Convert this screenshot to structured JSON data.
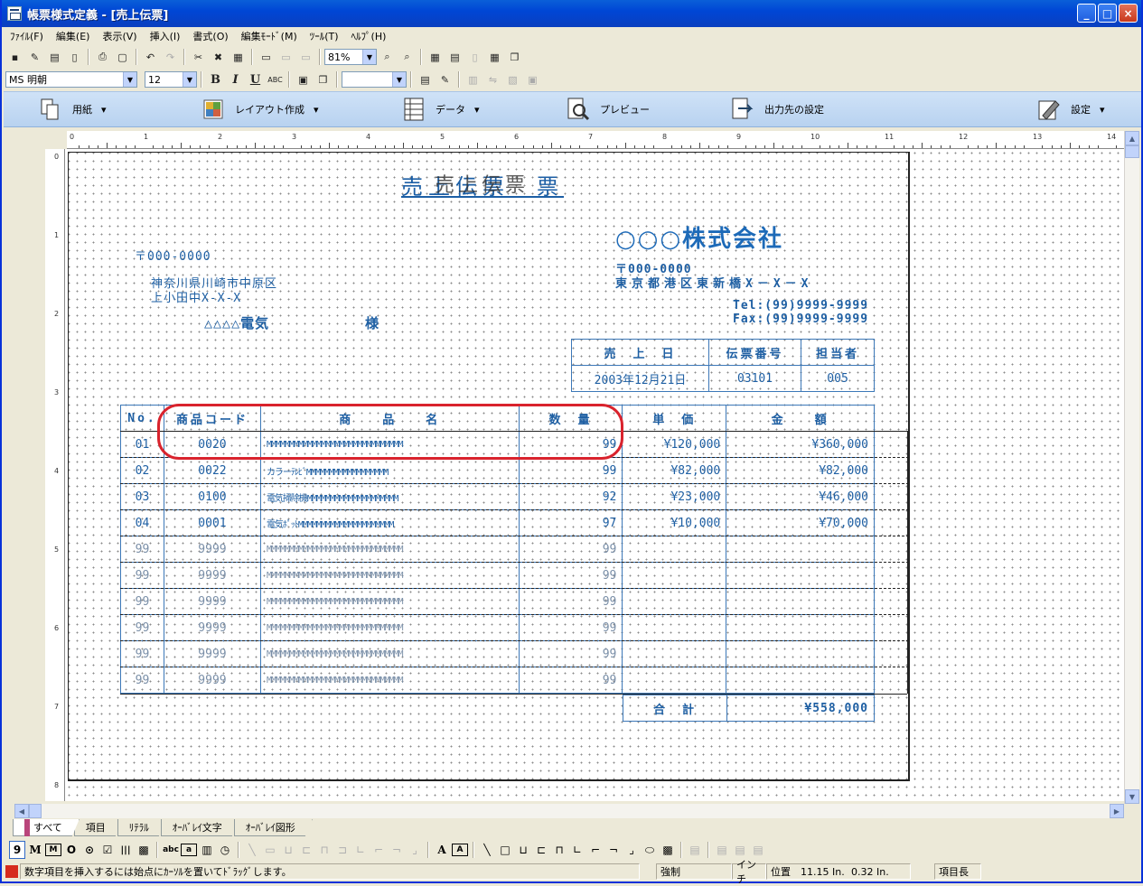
{
  "window": {
    "title": "帳票様式定義 - [売上伝票]",
    "controls": [
      "_",
      "□",
      "×"
    ]
  },
  "menu": [
    "ﾌｧｲﾙ(F)",
    "編集(E)",
    "表示(V)",
    "挿入(I)",
    "書式(O)",
    "編集ﾓｰﾄﾞ(M)",
    "ﾂｰﾙ(T)",
    "ﾍﾙﾌﾟ(H)"
  ],
  "toolbar": {
    "zoom": "81%",
    "font": "MS 明朝",
    "size": "12",
    "color_value": "",
    "bold": "B",
    "italic": "I",
    "underline": "U",
    "abc": "ABC"
  },
  "ribbon": {
    "paper": "用紙",
    "layout": "レイアウト作成",
    "data": "データ",
    "preview": "プレビュー",
    "output": "出力先の設定",
    "settings": "設定"
  },
  "ruler": {
    "h": [
      "0",
      "1",
      "2",
      "3",
      "4",
      "5",
      "6",
      "7",
      "8",
      "9",
      "10",
      "11",
      "12",
      "13",
      "14"
    ],
    "v": [
      "0",
      "1",
      "2",
      "3",
      "4",
      "5",
      "6",
      "7",
      "8"
    ]
  },
  "document": {
    "title": "売上伝票　票",
    "title_overlay": "売上伝票",
    "company": "○○○株式会社",
    "customer_zip": "〒000-0000",
    "customer_addr1": "神奈川県川崎市中原区",
    "customer_addr2": "上小田中X-X-X",
    "customer_name": "△△△△電気",
    "customer_honorific": "様",
    "company_zip": "〒000-0000",
    "company_addr": "東京都港区東新橋X－X－X",
    "tel": "Tel:(99)9999-9999",
    "fax": "Fax:(99)9999-9999",
    "info_headers": [
      "売　上　日",
      "伝票番号",
      "担当者"
    ],
    "info_values": [
      "2003年12月21日",
      "03101",
      "005"
    ],
    "table_headers": [
      "No.",
      "商品コード",
      "商　　品　　名",
      "数　量",
      "単　価",
      "金　　額"
    ],
    "rows": [
      [
        "01",
        "0020",
        "MMMMMMMMMMMMMMMMMMMMMMMMMMMMMM",
        "99",
        "¥120,000",
        "¥360,000"
      ],
      [
        "02",
        "0022",
        "カラーﾃﾚﾋﾞMMMMMMMMMMMMMMMMMM",
        "99",
        "¥82,000",
        "¥82,000"
      ],
      [
        "03",
        "0100",
        "電気掃除機MMMMMMMMMMMMMMMMMMMM",
        "92",
        "¥23,000",
        "¥46,000"
      ],
      [
        "04",
        "0001",
        "電気ﾎﾟｯﾄMMMMMMMMMMMMMMMMMMMMM",
        "97",
        "¥10,000",
        "¥70,000"
      ],
      [
        "99",
        "9999",
        "MMMMMMMMMMMMMMMMMMMMMMMMMMMMMM",
        "99",
        "",
        ""
      ],
      [
        "99",
        "9999",
        "MMMMMMMMMMMMMMMMMMMMMMMMMMMMMM",
        "99",
        "",
        ""
      ],
      [
        "99",
        "9999",
        "MMMMMMMMMMMMMMMMMMMMMMMMMMMMMM",
        "99",
        "",
        ""
      ],
      [
        "99",
        "9999",
        "MMMMMMMMMMMMMMMMMMMMMMMMMMMMMM",
        "99",
        "",
        ""
      ],
      [
        "99",
        "9999",
        "MMMMMMMMMMMMMMMMMMMMMMMMMMMMMM",
        "99",
        "",
        ""
      ],
      [
        "99",
        "9999",
        "MMMMMMMMMMMMMMMMMMMMMMMMMMMMMM",
        "99",
        "",
        ""
      ]
    ],
    "total_label": "合　計",
    "total_value": "¥558,000"
  },
  "tabs": [
    "すべて",
    "項目",
    "ﾘﾃﾗﾙ",
    "ｵｰﾊﾞﾚｲ文字",
    "ｵｰﾊﾞﾚｲ図形"
  ],
  "toolbox": [
    "9",
    "M",
    "M",
    "O",
    "⊙",
    "☑",
    "|||",
    "abc",
    "a",
    "A"
  ],
  "status": {
    "message": "数字項目を挿入するには始点にｶｰｿﾙを置いてﾄﾞﾗｯｸﾞします。",
    "mode1": "強制",
    "unit": "インチ",
    "pos_label": "位置",
    "x": "11.15 In.",
    "y": "0.32 In.",
    "field": "項目長"
  }
}
